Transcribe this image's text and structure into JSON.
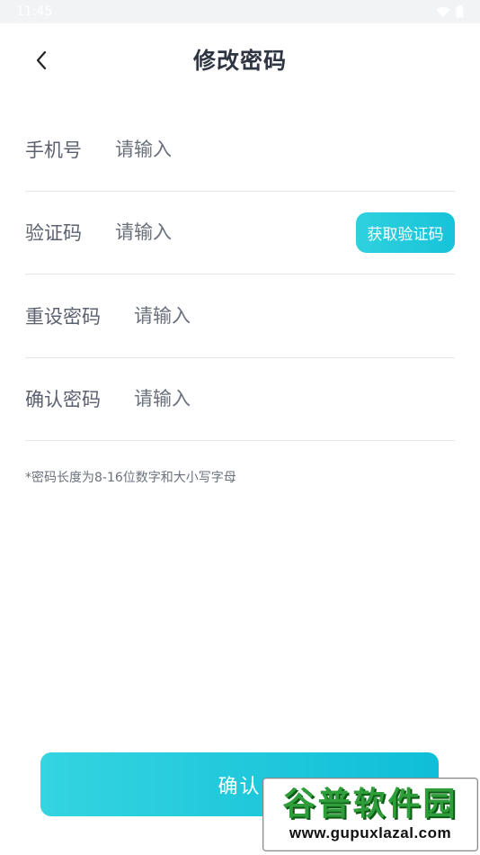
{
  "status_bar": {
    "time": "11:45"
  },
  "header": {
    "title": "修改密码"
  },
  "form": {
    "phone": {
      "label": "手机号",
      "placeholder": "请输入"
    },
    "code": {
      "label": "验证码",
      "placeholder": "请输入",
      "button": "获取验证码"
    },
    "new_password": {
      "label": "重设密码",
      "placeholder": "请输入"
    },
    "confirm_password": {
      "label": "确认密码",
      "placeholder": "请输入"
    }
  },
  "hint": "*密码长度为8-16位数字和大小写字母",
  "confirm_button": "确认",
  "watermark": {
    "name": "谷普软件园",
    "url": "www.gupuxlazal.com"
  },
  "colors": {
    "accent": "#1fc8db",
    "title": "#2f3542",
    "label": "#5b6170"
  }
}
